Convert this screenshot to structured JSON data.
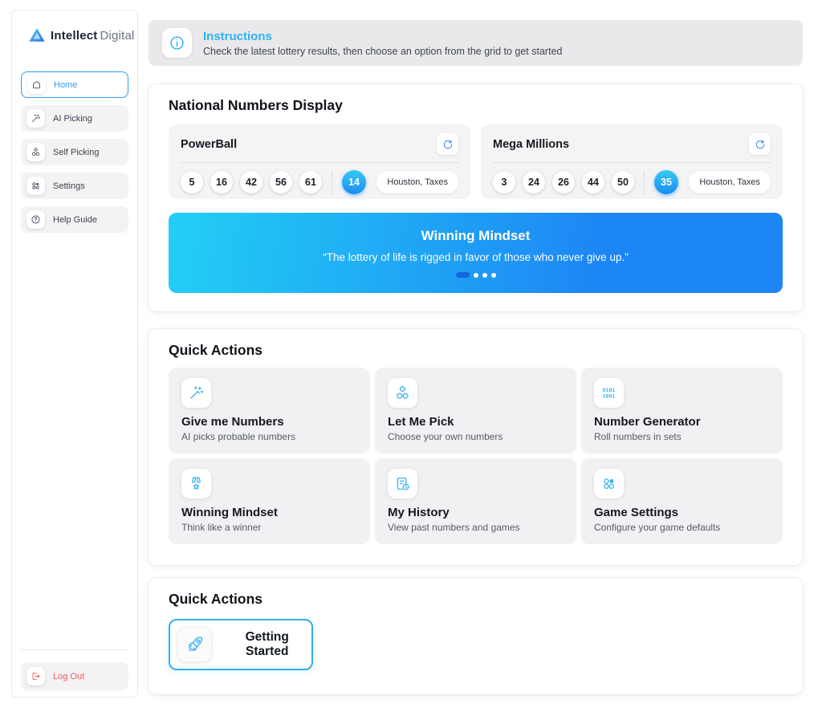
{
  "brand": {
    "name_bold": "Intellect",
    "name_light": "Digital"
  },
  "colors": {
    "accent_blue": "#2e9bf3",
    "icon_blue": "#3eb3f5",
    "banner_gradient_start": "#22cff4",
    "banner_gradient_end": "#1d86f5",
    "bonus_ball_gradient": [
      "#38c9f3",
      "#1b8cf0"
    ],
    "logout_red": "#ee5a5a",
    "instructions_bg": "#e9e9eb",
    "card_bg": "#f1f1f3"
  },
  "sidebar": {
    "items": [
      {
        "label": "Home",
        "icon": "home-icon",
        "active": true
      },
      {
        "label": "AI Picking",
        "icon": "magic-wand-icon",
        "active": false
      },
      {
        "label": "Self Picking",
        "icon": "picks-icon",
        "active": false
      },
      {
        "label": "Settings",
        "icon": "grid-dots-icon",
        "active": false
      },
      {
        "label": "Help Guide",
        "icon": "question-circle-icon",
        "active": false
      }
    ],
    "logout_label": "Log Out"
  },
  "instructions": {
    "title": "Instructions",
    "subtitle": "Check the latest lottery results, then choose an option from the grid to get started",
    "icon": "info-circle-icon"
  },
  "national": {
    "heading": "National Numbers Display",
    "games": [
      {
        "name": "PowerBall",
        "numbers": [
          "5",
          "16",
          "42",
          "56",
          "61"
        ],
        "bonus": "14",
        "location": "Houston, Taxes"
      },
      {
        "name": "Mega Millions",
        "numbers": [
          "3",
          "24",
          "26",
          "44",
          "50"
        ],
        "bonus": "35",
        "location": "Houston, Taxes"
      }
    ],
    "banner": {
      "title": "Winning Mindset",
      "quote": "“The lottery of life is rigged in favor of those who never give up.”",
      "dot_count": 4,
      "active_dot_index": 0
    }
  },
  "quick_actions": {
    "heading": "Quick Actions",
    "cards": [
      {
        "title": "Give me Numbers",
        "subtitle": "AI picks probable numbers",
        "icon": "magic-wand-icon"
      },
      {
        "title": "Let Me Pick",
        "subtitle": "Choose your own numbers",
        "icon": "picks-icon"
      },
      {
        "title": "Number Generator",
        "subtitle": "Roll numbers in sets",
        "icon": "binary-icon",
        "icon_text": [
          "0101",
          "1001"
        ]
      },
      {
        "title": "Winning Mindset",
        "subtitle": "Think like a winner",
        "icon": "medal-icon"
      },
      {
        "title": "My History",
        "subtitle": "View past numbers and games",
        "icon": "history-icon"
      },
      {
        "title": "Game Settings",
        "subtitle": "Configure your game defaults",
        "icon": "grid-dots-icon"
      }
    ]
  },
  "bottom_actions": {
    "heading": "Quick Actions",
    "button_label": "Getting Started",
    "button_icon": "rocket-icon"
  }
}
